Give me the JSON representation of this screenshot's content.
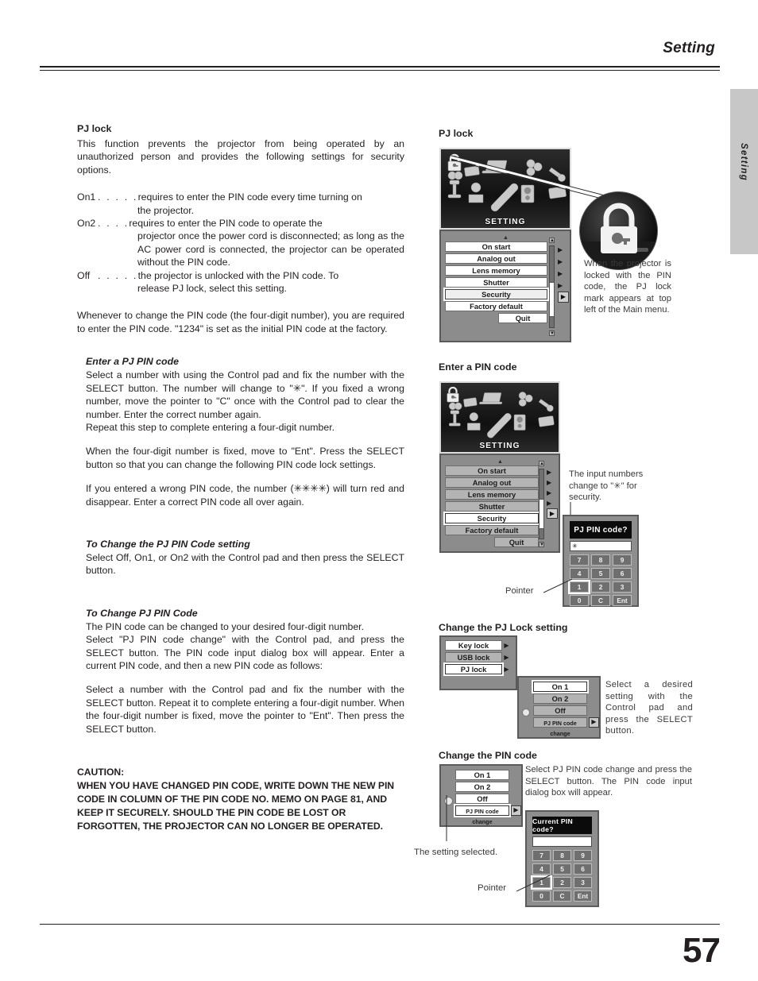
{
  "header": {
    "title": "Setting",
    "side_tab": "Setting"
  },
  "footer": {
    "page_number": "57"
  },
  "left": {
    "h1": "PJ lock",
    "intro": "This function prevents the projector from being operated by an unauthorized person and provides the following settings for security options.",
    "options": [
      {
        "term": "On1",
        "dots": ". . . . .",
        "text": "requires to enter the PIN code every time turning on",
        "cont": "the projector."
      },
      {
        "term": "On2",
        "dots": ". . . .",
        "text": "requires to enter the PIN code to operate the",
        "cont": "projector once the power cord is disconnected; as long as the AC power cord is connected, the projector can be operated without the PIN code."
      },
      {
        "term": "Off",
        "dots": ". . . . .",
        "text": "the projector is unlocked with the PIN code.  To",
        "cont": "release PJ lock, select this setting."
      }
    ],
    "p_whenever": "Whenever to change the PIN code (the four-digit number), you are required to enter the PIN code.  \"1234\" is set as the initial PIN code at the factory.",
    "h2": "Enter a PJ PIN code",
    "p_enter_1": "Select a number with using the Control pad and fix the number with the SELECT button.  The number will change to \"✳\".  If you fixed a wrong number, move the pointer to \"C\" once with the Control pad to clear the number.  Enter the correct number again.",
    "p_enter_2": "Repeat this step to complete entering a four-digit number.",
    "p_enter_3": "When the four-digit number is fixed, move to \"Ent\".  Press the SELECT button so that you can change the following PIN code lock settings.",
    "p_enter_4": "If you entered a wrong PIN code, the number (✳✳✳✳) will turn red and disappear.  Enter a correct PIN code all over again.",
    "h3": "To Change the PJ PIN Code setting",
    "p_change_setting": "Select Off, On1, or On2 with the Control pad and then press the SELECT button.",
    "h4": "To Change PJ PIN Code",
    "p_change_1": "The PIN code can be changed to your desired four-digit number.",
    "p_change_2": "Select \"PJ PIN code change\" with the Control pad, and press the SELECT button.  The PIN code input dialog box will appear. Enter a current PIN code, and then a new PIN code as follows:",
    "p_change_3": "Select a number with the Control pad and fix the number with the SELECT button. Repeat it to complete entering a four-digit number.  When the four-digit number is fixed, move the pointer to \"Ent\".  Then press the SELECT button.",
    "caution_label": "CAUTION:",
    "caution_body": "WHEN YOU HAVE CHANGED PIN CODE, WRITE DOWN THE NEW PIN CODE IN COLUMN OF THE PIN CODE NO. MEMO ON PAGE 81, AND KEEP IT SECURELY.  SHOULD THE PIN CODE BE LOST OR FORGOTTEN, THE PROJECTOR CAN NO LONGER BE OPERATED."
  },
  "right": {
    "sec1_title": "PJ lock",
    "sec2_title": "Enter a PIN code",
    "sec3_title": "Change the PJ Lock setting",
    "sec4_title": "Change the PIN code",
    "osd_setting_label": "SETTING",
    "menu_items": [
      "On start",
      "Analog out",
      "Lens memory",
      "Shutter",
      "Security",
      "Factory default"
    ],
    "menu_quit": "Quit",
    "caption_lock": "When the projector is locked with the PIN code,  the PJ lock mark appears  at  top left of the Main menu.",
    "caption_input": "The input numbers change to \"✳\" for security.",
    "caption_select": "Select a desired setting with the Control pad and press the SELECT button.",
    "caption_change": "Select PJ PIN code change and press the SELECT button.  The PIN code input dialog box will appear.",
    "caption_setting_selected": "The setting selected.",
    "label_pointer": "Pointer",
    "pin_dialog_1": {
      "title": "PJ PIN code?",
      "field_value": "✳",
      "keys": [
        [
          "7",
          "8",
          "9"
        ],
        [
          "4",
          "5",
          "6"
        ],
        [
          "1",
          "2",
          "3"
        ],
        [
          "0",
          "C",
          "Ent"
        ]
      ],
      "highlight_key": "1"
    },
    "pin_dialog_2": {
      "title": "Current PIN code?",
      "field_value": "",
      "keys": [
        [
          "7",
          "8",
          "9"
        ],
        [
          "4",
          "5",
          "6"
        ],
        [
          "1",
          "2",
          "3"
        ],
        [
          "0",
          "C",
          "Ent"
        ]
      ],
      "highlight_key": "1"
    },
    "lock_menu": {
      "items": [
        "Key lock",
        "USB lock",
        "PJ lock"
      ],
      "selected": "PJ lock"
    },
    "pjlock_options": {
      "items": [
        "On 1",
        "On 2",
        "Off",
        "PJ PIN code change"
      ],
      "selected": "On 1"
    },
    "pjlock_options2": {
      "items": [
        "On 1",
        "On 2",
        "Off",
        "PJ PIN code change"
      ],
      "selected": "PJ PIN code change"
    }
  },
  "colors": {
    "ink": "#231f20",
    "osd_bg": "#8e8e8e",
    "tab_gray": "#c7c7c7"
  }
}
